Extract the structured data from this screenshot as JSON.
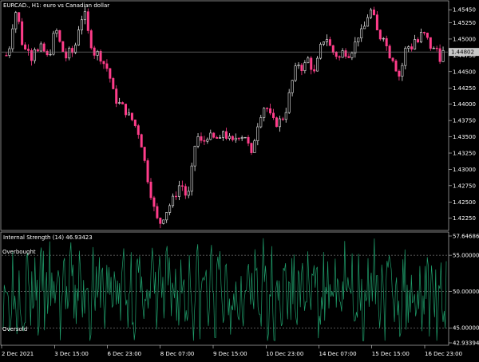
{
  "window": {
    "symbol_caption": "EURCAD., H1:  euro vs Canadian dollar"
  },
  "price_panel": {
    "axis_ticks": [
      "1.45450",
      "1.45250",
      "1.45000",
      "1.44750",
      "1.44500",
      "1.44250",
      "1.44000",
      "1.43750",
      "1.43500",
      "1.43250",
      "1.43000",
      "1.42750",
      "1.42500",
      "1.42250"
    ],
    "axis_values": [
      1.4545,
      1.4525,
      1.45,
      1.4475,
      1.445,
      1.4425,
      1.44,
      1.4375,
      1.435,
      1.4325,
      1.43,
      1.4275,
      1.425,
      1.4225
    ],
    "current_price_label": "1.44802",
    "current_price": 1.44802,
    "ylim": [
      1.421,
      1.4555
    ],
    "up_color": "#e8e8e8",
    "down_color": "#ff3d8a"
  },
  "indicator_panel": {
    "caption": "Internal Strength (14) 46.93423",
    "overbought_label": "Overbought",
    "oversold_label": "Oversold",
    "axis_ticks": [
      "57.64686",
      "55.00000",
      "50.00000",
      "45.00000",
      "42.93394"
    ],
    "levels": {
      "overbought": 55.0,
      "middle": 50.0,
      "oversold": 45.0
    },
    "ylim": [
      42.93394,
      57.64686
    ],
    "line_color": "#1f9e6b"
  },
  "time_axis": {
    "labels": [
      "2 Dec 2021",
      "3 Dec 15:00",
      "6 Dec 23:00",
      "8 Dec 07:00",
      "9 Dec 15:00",
      "10 Dec 23:00",
      "14 Dec 07:00",
      "15 Dec 15:00",
      "16 Dec 23:00"
    ]
  },
  "chart_data": [
    {
      "type": "candlestick",
      "title": "EURCAD., H1:  euro vs Canadian dollar",
      "ylim": [
        1.421,
        1.4555
      ],
      "x": [
        "2 Dec 2021",
        "3 Dec 15:00",
        "6 Dec 23:00",
        "8 Dec 07:00",
        "9 Dec 15:00",
        "10 Dec 23:00",
        "14 Dec 07:00",
        "15 Dec 15:00",
        "16 Dec 23:00"
      ],
      "close_path": [
        1.4475,
        1.449,
        1.453,
        1.4548,
        1.4505,
        1.448,
        1.4492,
        1.447,
        1.4488,
        1.4478,
        1.449,
        1.4475,
        1.447,
        1.45,
        1.4515,
        1.4495,
        1.448,
        1.447,
        1.4485,
        1.4475,
        1.451,
        1.453,
        1.454,
        1.451,
        1.449,
        1.4475,
        1.448,
        1.4465,
        1.446,
        1.4445,
        1.442,
        1.4405,
        1.44,
        1.4395,
        1.4385,
        1.438,
        1.437,
        1.436,
        1.434,
        1.431,
        1.428,
        1.4255,
        1.423,
        1.4215,
        1.4225,
        1.4235,
        1.4245,
        1.4255,
        1.4265,
        1.428,
        1.427,
        1.425,
        1.429,
        1.4335,
        1.435,
        1.434,
        1.4345,
        1.4355,
        1.4345,
        1.435,
        1.434,
        1.436,
        1.435,
        1.4345,
        1.434,
        1.4355,
        1.435,
        1.4355,
        1.434,
        1.432,
        1.435,
        1.4375,
        1.439,
        1.44,
        1.4385,
        1.4375,
        1.437,
        1.4375,
        1.438,
        1.4395,
        1.4425,
        1.4445,
        1.4465,
        1.4455,
        1.446,
        1.447,
        1.4455,
        1.4445,
        1.448,
        1.4495,
        1.4505,
        1.449,
        1.448,
        1.4475,
        1.447,
        1.4485,
        1.4475,
        1.448,
        1.449,
        1.4505,
        1.451,
        1.452,
        1.454,
        1.4545,
        1.452,
        1.45,
        1.451,
        1.449,
        1.4475,
        1.447,
        1.445,
        1.444,
        1.448,
        1.449,
        1.4485,
        1.45,
        1.4495,
        1.451,
        1.4505,
        1.4495,
        1.448,
        1.449,
        1.447,
        1.448
      ]
    },
    {
      "type": "line",
      "title": "Internal Strength (14) 46.93423",
      "ylim": [
        42.93394,
        57.64686
      ],
      "levels": [
        55.0,
        50.0,
        45.0
      ]
    }
  ]
}
